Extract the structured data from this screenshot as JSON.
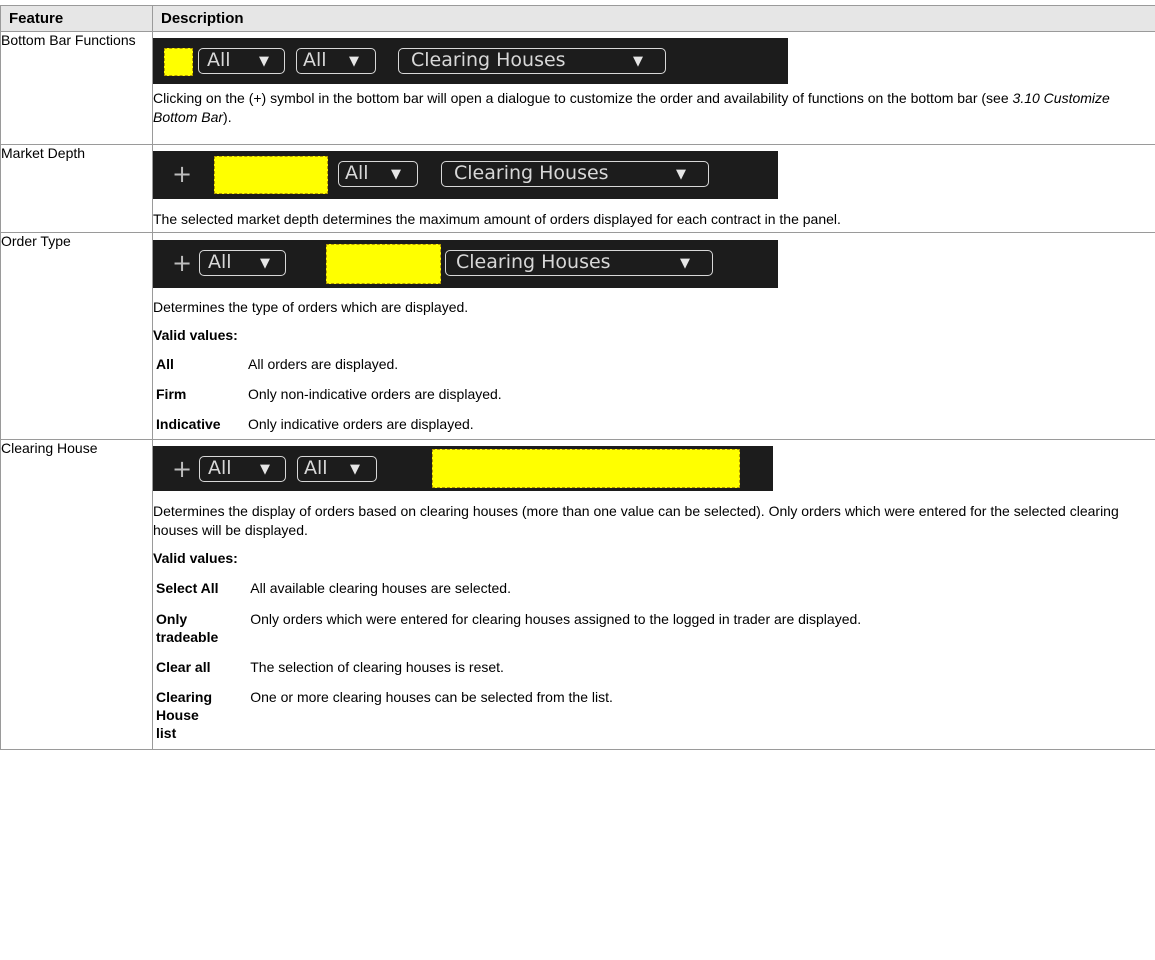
{
  "table": {
    "headers": {
      "feature": "Feature",
      "description": "Description"
    },
    "rows": {
      "bottom_bar": {
        "feature": "Bottom Bar Functions",
        "bar": {
          "dd1": "All",
          "dd2": "All",
          "dd3": "Clearing Houses"
        },
        "text_before": "Clicking on the (+) symbol in the bottom bar will open a dialogue to customize the order and availability of functions on the bottom bar (see ",
        "text_ref": "3.10 Customize Bottom Bar",
        "text_after": ")."
      },
      "market_depth": {
        "feature": "Market Depth",
        "bar": {
          "plus": "+",
          "dd2": "All",
          "dd3": "Clearing Houses"
        },
        "text": "The selected market depth determines the maximum amount of orders displayed for each contract in the panel."
      },
      "order_type": {
        "feature": "Order Type",
        "bar": {
          "plus": "+",
          "dd1": "All",
          "dd3": "Clearing Houses"
        },
        "text": "Determines the type of orders which are displayed.",
        "valid_label": "Valid values:",
        "values": [
          {
            "key": "All",
            "desc": "All orders are displayed."
          },
          {
            "key": "Firm",
            "desc": "Only non-indicative orders are displayed."
          },
          {
            "key": "Indicative",
            "desc": "Only indicative orders are displayed."
          }
        ]
      },
      "clearing_house": {
        "feature": "Clearing House",
        "bar": {
          "plus": "+",
          "dd1": "All",
          "dd2": "All"
        },
        "text": "Determines the display of orders based on clearing houses (more than one value can be selected). Only orders which were entered for the selected clearing houses will be displayed.",
        "valid_label": "Valid values:",
        "values": [
          {
            "key": "Select All",
            "desc": "All available clearing houses are selected."
          },
          {
            "key": "Only tradeable",
            "desc": "Only orders which were entered for clearing houses assigned to the logged in trader are displayed."
          },
          {
            "key": "Clear all",
            "desc": "The selection of clearing houses is reset."
          },
          {
            "key": "Clearing House list",
            "desc": "One or more clearing houses can be selected from the list."
          }
        ]
      }
    }
  },
  "colors": {
    "bar_background": "#1c1c1c",
    "highlight": "#ffff00",
    "header_background": "#e6e6e6"
  },
  "icons": {
    "caret": "caret-down-icon",
    "plus": "plus-icon"
  }
}
